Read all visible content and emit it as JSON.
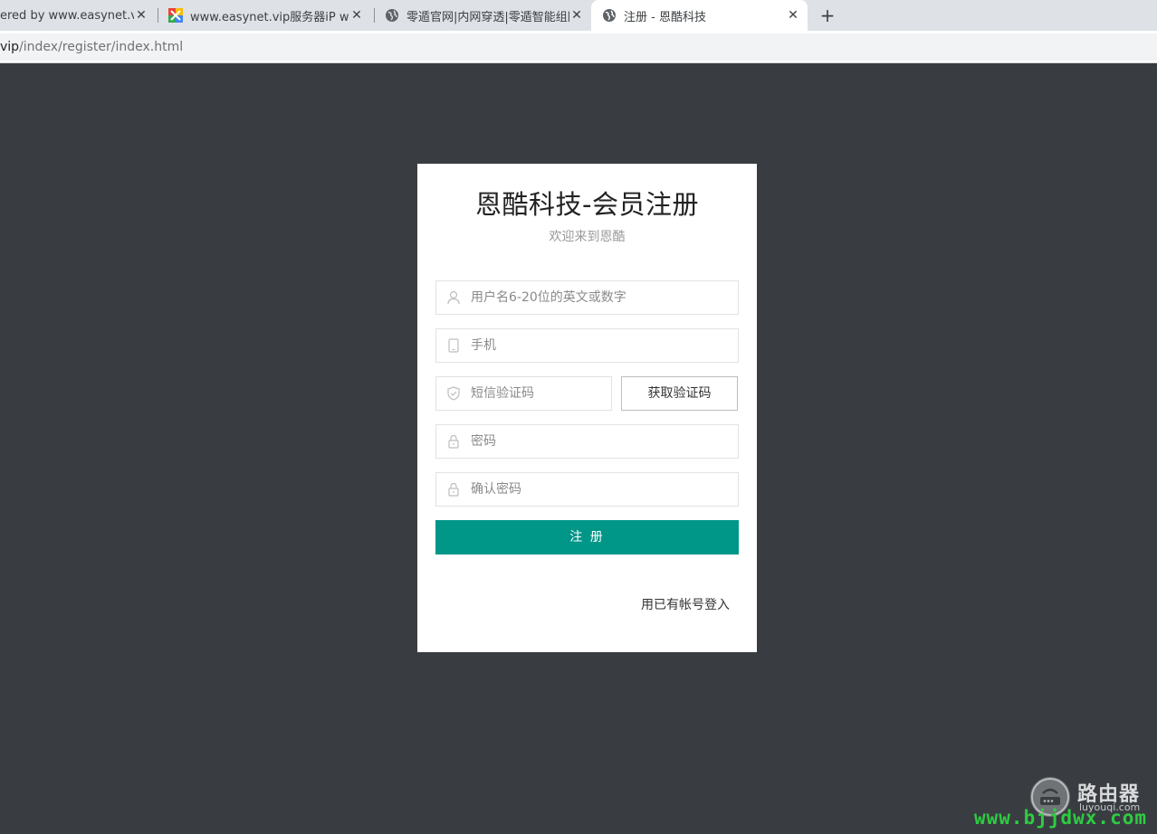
{
  "browser": {
    "tabs": [
      {
        "title": "ered by www.easynet.vip_",
        "favicon": "none",
        "active": false
      },
      {
        "title": "www.easynet.vip服务器iP www.",
        "favicon": "colorful-grid-icon",
        "active": false
      },
      {
        "title": "零遁官网|内网穿透|零遁智能组网",
        "favicon": "globe-icon",
        "active": false
      },
      {
        "title": "注册 - 恩酷科技",
        "favicon": "globe-icon",
        "active": true
      }
    ],
    "new_tab_label": "+",
    "close_glyph": "✕",
    "url_host": "vip",
    "url_path": "/index/register/index.html"
  },
  "register": {
    "title": "恩酷科技-会员注册",
    "subtitle": "欢迎来到恩酷",
    "fields": {
      "username_placeholder": "用户名6-20位的英文或数字",
      "phone_placeholder": "手机",
      "sms_code_placeholder": "短信验证码",
      "password_placeholder": "密码",
      "confirm_password_placeholder": "确认密码"
    },
    "get_code_label": "获取验证码",
    "submit_label": "注 册",
    "login_link_label": "用已有帐号登入"
  },
  "theme": {
    "background": "#393d42",
    "accent": "#009688"
  },
  "watermark": {
    "brand_cn": "路由器",
    "brand_en": "luyouqi.com",
    "site": "www.bjjdwx.com"
  }
}
